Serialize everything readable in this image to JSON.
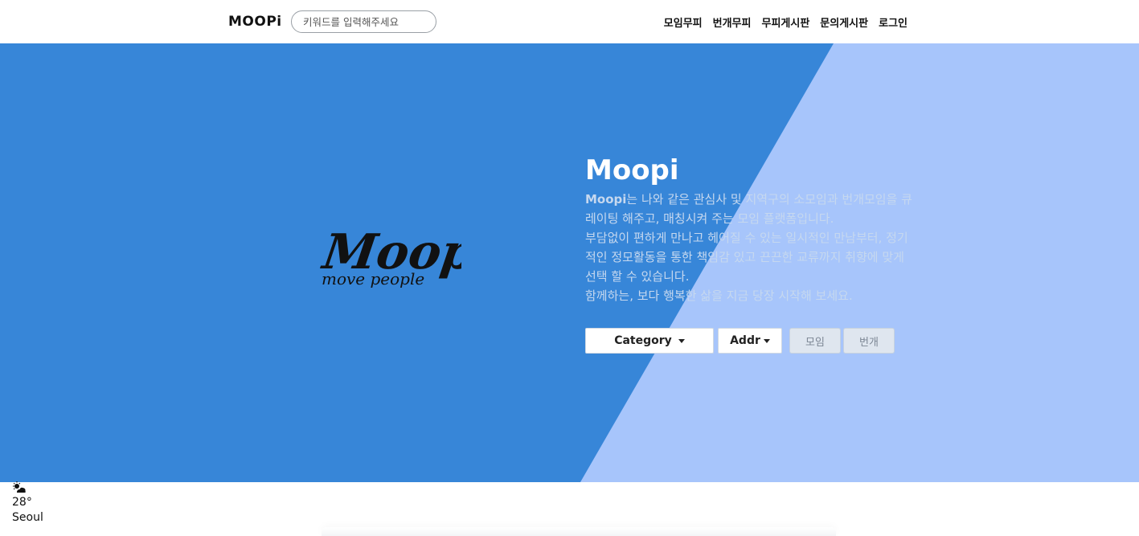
{
  "nav": {
    "logo": "MOOPi",
    "search_placeholder": "키워드를 입력해주세요",
    "links": [
      "모임무피",
      "번개무피",
      "무피게시판",
      "문의게시판",
      "로그인"
    ]
  },
  "hero": {
    "logo_text": "Moopi",
    "logo_tagline": "move people",
    "title": "Moopi",
    "desc_brand": "Moopi",
    "desc_line1": "는 나와 같은 관심사 및 지역구의 소모임과 번개모임을 큐레이팅 해주고, 매칭시켜 주는 모임 플랫폼입니다.",
    "desc_line2": "부담없이 편하게 만나고 헤어질 수 있는 일시적인 만남부터, 정기적인 정모활동을 통한 책임감 있고 끈끈한 교류까지 취향에 맞게 선택 할 수 있습니다.",
    "desc_line3": "함께하는, 보다 행복한 삶을 지금 당장 시작해 보세요."
  },
  "controls": {
    "category_label": "Category",
    "addr_label": "Addr",
    "moim_label": "모임",
    "bungae_label": "번개"
  },
  "weather": {
    "icon": "partly-cloudy-icon",
    "temp": "28°",
    "city": "Seoul"
  },
  "colors": {
    "hero_blue": "#3786d8",
    "hero_light": "#a7c5fb"
  }
}
